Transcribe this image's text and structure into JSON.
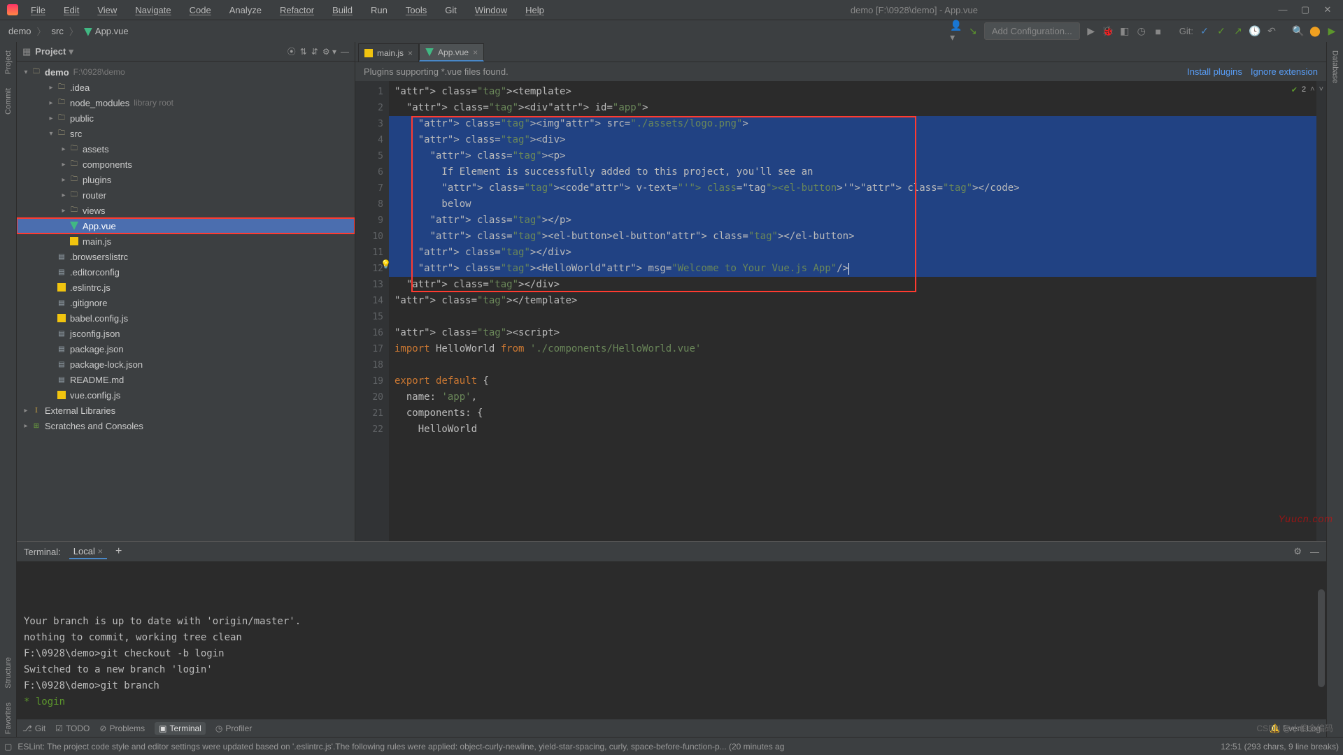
{
  "window": {
    "title": "demo [F:\\0928\\demo] - App.vue",
    "menu": [
      "File",
      "Edit",
      "View",
      "Navigate",
      "Code",
      "Analyze",
      "Refactor",
      "Build",
      "Run",
      "Tools",
      "Git",
      "Window",
      "Help"
    ]
  },
  "breadcrumbs": [
    "demo",
    "src",
    "App.vue"
  ],
  "toolbar": {
    "addConfig": "Add Configuration...",
    "gitLabel": "Git:"
  },
  "project": {
    "title": "Project",
    "root": {
      "name": "demo",
      "path": "F:\\0928\\demo"
    },
    "items": [
      {
        "name": ".idea",
        "type": "dir",
        "indent": 2
      },
      {
        "name": "node_modules",
        "hint": "library root",
        "type": "dir",
        "indent": 2
      },
      {
        "name": "public",
        "type": "dir",
        "indent": 2
      },
      {
        "name": "src",
        "type": "dir",
        "indent": 2,
        "open": true
      },
      {
        "name": "assets",
        "type": "dir",
        "indent": 3
      },
      {
        "name": "components",
        "type": "dir",
        "indent": 3
      },
      {
        "name": "plugins",
        "type": "dir",
        "indent": 3
      },
      {
        "name": "router",
        "type": "dir",
        "indent": 3
      },
      {
        "name": "views",
        "type": "dir",
        "indent": 3
      },
      {
        "name": "App.vue",
        "type": "vue",
        "indent": 3,
        "selected": true,
        "highlighted": true
      },
      {
        "name": "main.js",
        "type": "js",
        "indent": 3
      },
      {
        "name": ".browserslistrc",
        "type": "file",
        "indent": 2
      },
      {
        "name": ".editorconfig",
        "type": "file",
        "indent": 2
      },
      {
        "name": ".eslintrc.js",
        "type": "js",
        "indent": 2
      },
      {
        "name": ".gitignore",
        "type": "file",
        "indent": 2
      },
      {
        "name": "babel.config.js",
        "type": "js",
        "indent": 2
      },
      {
        "name": "jsconfig.json",
        "type": "file",
        "indent": 2
      },
      {
        "name": "package.json",
        "type": "file",
        "indent": 2
      },
      {
        "name": "package-lock.json",
        "type": "file",
        "indent": 2
      },
      {
        "name": "README.md",
        "type": "file",
        "indent": 2
      },
      {
        "name": "vue.config.js",
        "type": "js",
        "indent": 2
      }
    ],
    "externalLibs": "External Libraries",
    "scratches": "Scratches and Consoles"
  },
  "tabs": [
    {
      "label": "main.js",
      "icon": "js"
    },
    {
      "label": "App.vue",
      "icon": "vue",
      "active": true
    }
  ],
  "notice": {
    "msg": "Plugins supporting *.vue files found.",
    "install": "Install plugins",
    "ignore": "Ignore extension"
  },
  "code": {
    "lines": [
      "<template>",
      "  <div id=\"app\">",
      "    <img src=\"./assets/logo.png\">",
      "    <div>",
      "      <p>",
      "        If Element is successfully added to this project, you'll see an",
      "        <code v-text=\"'<el-button>'\"></code>",
      "        below",
      "      </p>",
      "      <el-button>el-button</el-button>",
      "    </div>",
      "    <HelloWorld msg=\"Welcome to Your Vue.js App\"/>",
      "  </div>",
      "</template>",
      "",
      "<script>",
      "import HelloWorld from './components/HelloWorld.vue'",
      "",
      "export default {",
      "  name: 'app',",
      "  components: {",
      "    HelloWorld"
    ],
    "checkCount": "2"
  },
  "terminal": {
    "title": "Terminal:",
    "tab": "Local",
    "lines": [
      "Your branch is up to date with 'origin/master'.",
      "nothing to commit, working tree clean",
      "",
      "F:\\0928\\demo>git checkout -b login",
      "Switched to a new branch 'login'",
      "",
      "F:\\0928\\demo>git branch",
      "* login"
    ]
  },
  "bottomTabs": [
    {
      "label": "Git",
      "icon": "⎇"
    },
    {
      "label": "TODO",
      "icon": "☑"
    },
    {
      "label": "Problems",
      "icon": "⊘"
    },
    {
      "label": "Terminal",
      "icon": "▣",
      "active": true
    },
    {
      "label": "Profiler",
      "icon": "◷"
    }
  ],
  "eventLog": "Event Log",
  "status": {
    "msg": "ESLint: The project code style and editor settings were updated based on '.eslintrc.js'.The following rules were applied: object-curly-newline, yield-star-spacing, curly, space-before-function-p... (20 minutes ag",
    "pos": "12:51 (293 chars, 9 line breaks)",
    "watermark2": "CSDN @小俊会编码"
  },
  "leftStrip": [
    "Project",
    "Commit",
    "Structure",
    "Favorites"
  ],
  "rightStrip": [
    "Database"
  ],
  "watermark": "Yuucn.com"
}
